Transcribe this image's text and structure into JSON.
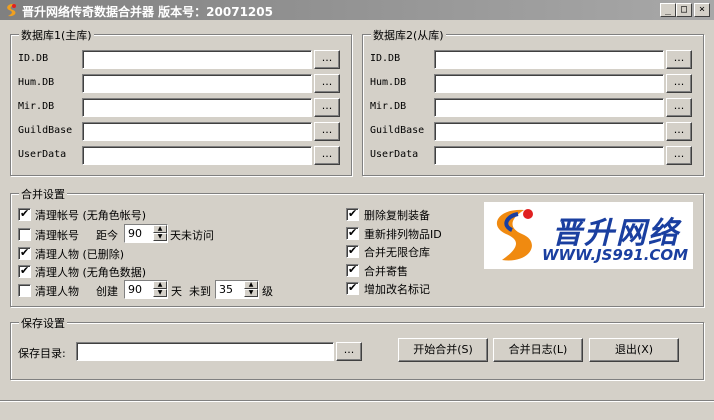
{
  "window": {
    "title": "晋升网络传奇数据合并器 版本号：20071205"
  },
  "db1": {
    "legend": "数据库1(主库)",
    "rows": [
      {
        "label": "ID.DB",
        "value": ""
      },
      {
        "label": "Hum.DB",
        "value": ""
      },
      {
        "label": "Mir.DB",
        "value": ""
      },
      {
        "label": "GuildBase",
        "value": ""
      },
      {
        "label": "UserData",
        "value": ""
      }
    ]
  },
  "db2": {
    "legend": "数据库2(从库)",
    "rows": [
      {
        "label": "ID.DB",
        "value": ""
      },
      {
        "label": "Hum.DB",
        "value": ""
      },
      {
        "label": "Mir.DB",
        "value": ""
      },
      {
        "label": "GuildBase",
        "value": ""
      },
      {
        "label": "UserData",
        "value": ""
      }
    ]
  },
  "browse_label": "...",
  "merge": {
    "legend": "合并设置",
    "opt1": {
      "label": "清理帐号 (无角色帐号)",
      "checked": true
    },
    "opt2": {
      "label": "清理帐号",
      "checked": false,
      "pre": "距今",
      "days": "90",
      "post": "天未访问"
    },
    "opt3": {
      "label": "清理人物 (已删除)",
      "checked": true
    },
    "opt4": {
      "label": "清理人物 (无角色数据)",
      "checked": true
    },
    "opt5": {
      "label": "清理人物",
      "checked": false,
      "pre": "创建",
      "days": "90",
      "mid": "天",
      "pre2": "未到",
      "level": "35",
      "post": "级"
    },
    "right": [
      {
        "label": "删除复制装备",
        "checked": true
      },
      {
        "label": "重新排列物品ID",
        "checked": true
      },
      {
        "label": "合并无限仓库",
        "checked": true
      },
      {
        "label": "合并寄售",
        "checked": true
      },
      {
        "label": "增加改名标记",
        "checked": true
      }
    ]
  },
  "logo": {
    "text": "晋升网络",
    "url": "WWW.JS991.COM"
  },
  "save": {
    "legend": "保存设置",
    "label": "保存目录:",
    "value": "",
    "start": "开始合并(S)",
    "log": "合并日志(L)",
    "exit": "退出(X)"
  },
  "colors": {
    "logo_red": "#e02020",
    "logo_blue": "#1a3fa0",
    "logo_orange": "#f08a10"
  }
}
